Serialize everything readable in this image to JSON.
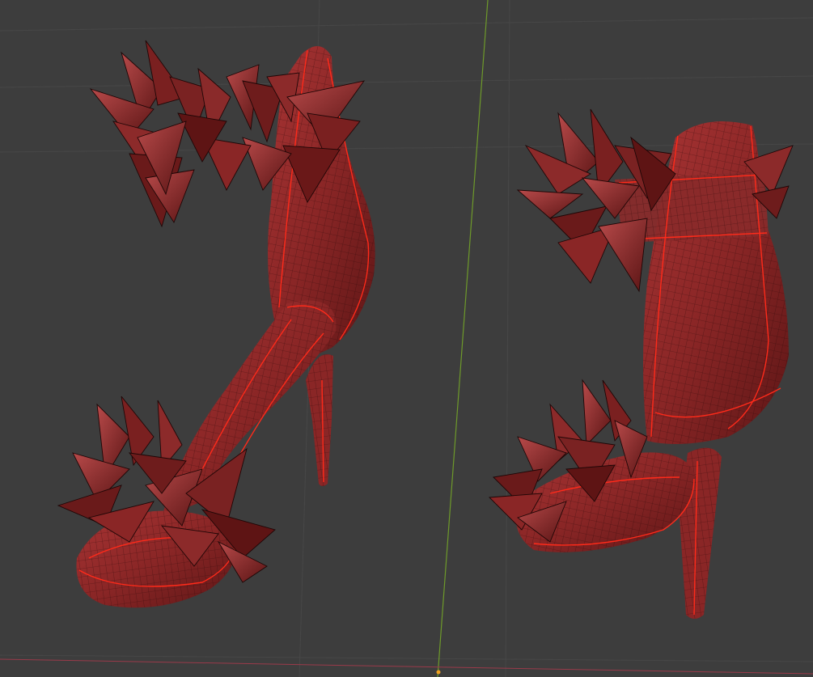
{
  "viewport": {
    "background_color": "#3d3d3d",
    "grid_line_color": "#474747",
    "y_axis_color": "#6e9a2a",
    "x_axis_color": "#9a3a4a",
    "origin_marker_color": "#f0a020"
  },
  "scene": {
    "objects": [
      {
        "name": "sandal-left",
        "display": "wireframe-overlay",
        "color": "#8c2a2a",
        "seam_color": "#ff2a1a"
      },
      {
        "name": "sandal-right",
        "display": "wireframe-overlay",
        "color": "#8c2a2a",
        "seam_color": "#ff2a1a"
      }
    ]
  }
}
